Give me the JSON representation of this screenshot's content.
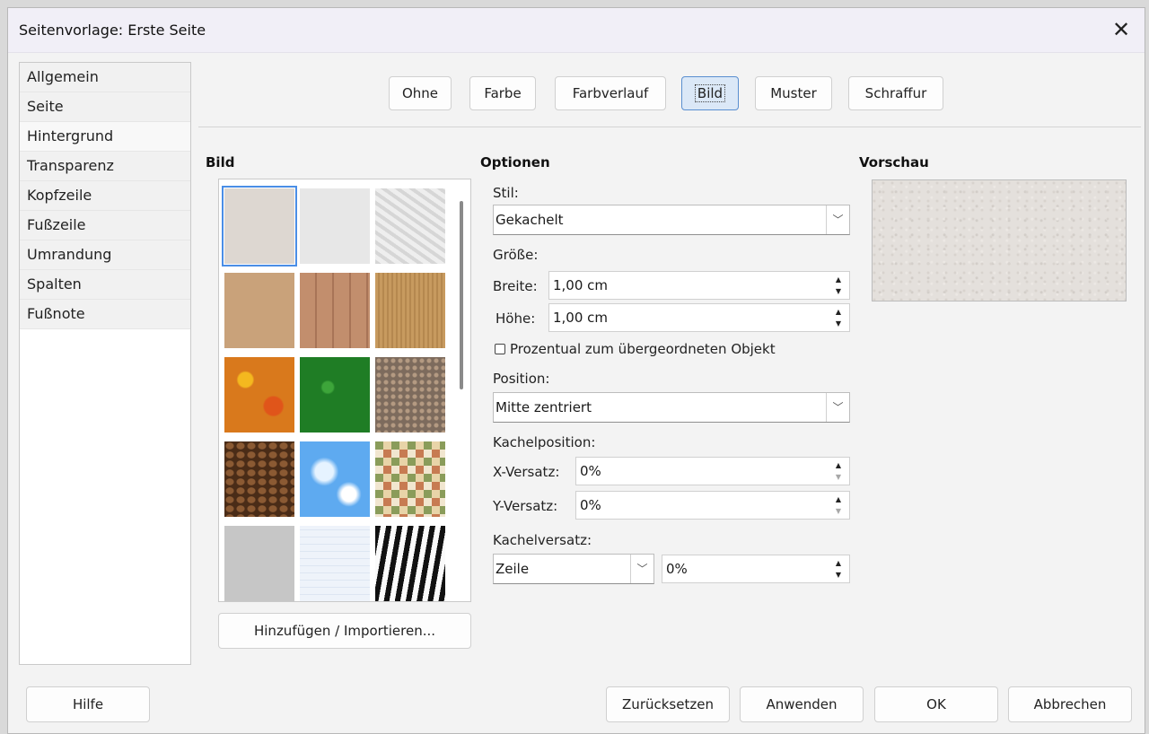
{
  "window": {
    "title": "Seitenvorlage: Erste Seite",
    "close": "✕"
  },
  "nav": {
    "items": [
      "Allgemein",
      "Seite",
      "Hintergrund",
      "Transparenz",
      "Kopfzeile",
      "Fußzeile",
      "Umrandung",
      "Spalten",
      "Fußnote"
    ],
    "active": "Hintergrund"
  },
  "tabs": {
    "none": "Ohne",
    "color": "Farbe",
    "gradient": "Farbverlauf",
    "image": "Bild",
    "pattern": "Muster",
    "hatch": "Schraffur",
    "active": "Bild"
  },
  "image_section": {
    "heading": "Bild",
    "add_import": "Hinzufügen / Importieren...",
    "thumbnails": [
      "beige-paper",
      "light-paper",
      "crumpled-paper",
      "cardboard",
      "wood-planks",
      "wood-grain",
      "autumn-leaves",
      "green-grass",
      "pebbles",
      "coffee-beans",
      "sky-clouds",
      "color-mosaic",
      "concrete",
      "grid-paper",
      "zebra-stripes"
    ],
    "selected": "beige-paper"
  },
  "options": {
    "heading": "Optionen",
    "style_label": "Stil:",
    "style_value": "Gekachelt",
    "size_label": "Größe:",
    "width_label": "Breite:",
    "width_value": "1,00 cm",
    "height_label": "Höhe:",
    "height_value": "1,00 cm",
    "relative_label": "Prozentual zum übergeordneten Objekt",
    "relative_checked": false,
    "position_label": "Position:",
    "position_value": "Mitte zentriert",
    "tile_pos_label": "Kachelposition:",
    "x_offset_label": "X-Versatz:",
    "x_offset_value": "0%",
    "y_offset_label": "Y-Versatz:",
    "y_offset_value": "0%",
    "tile_offset_label": "Kachelversatz:",
    "tile_offset_mode": "Zeile",
    "tile_offset_value": "0%"
  },
  "preview": {
    "heading": "Vorschau"
  },
  "footer": {
    "help": "Hilfe",
    "reset": "Zurücksetzen",
    "apply": "Anwenden",
    "ok": "OK",
    "cancel": "Abbrechen"
  },
  "icons": {
    "up": "▲",
    "down": "▼",
    "combo": "﹀"
  }
}
